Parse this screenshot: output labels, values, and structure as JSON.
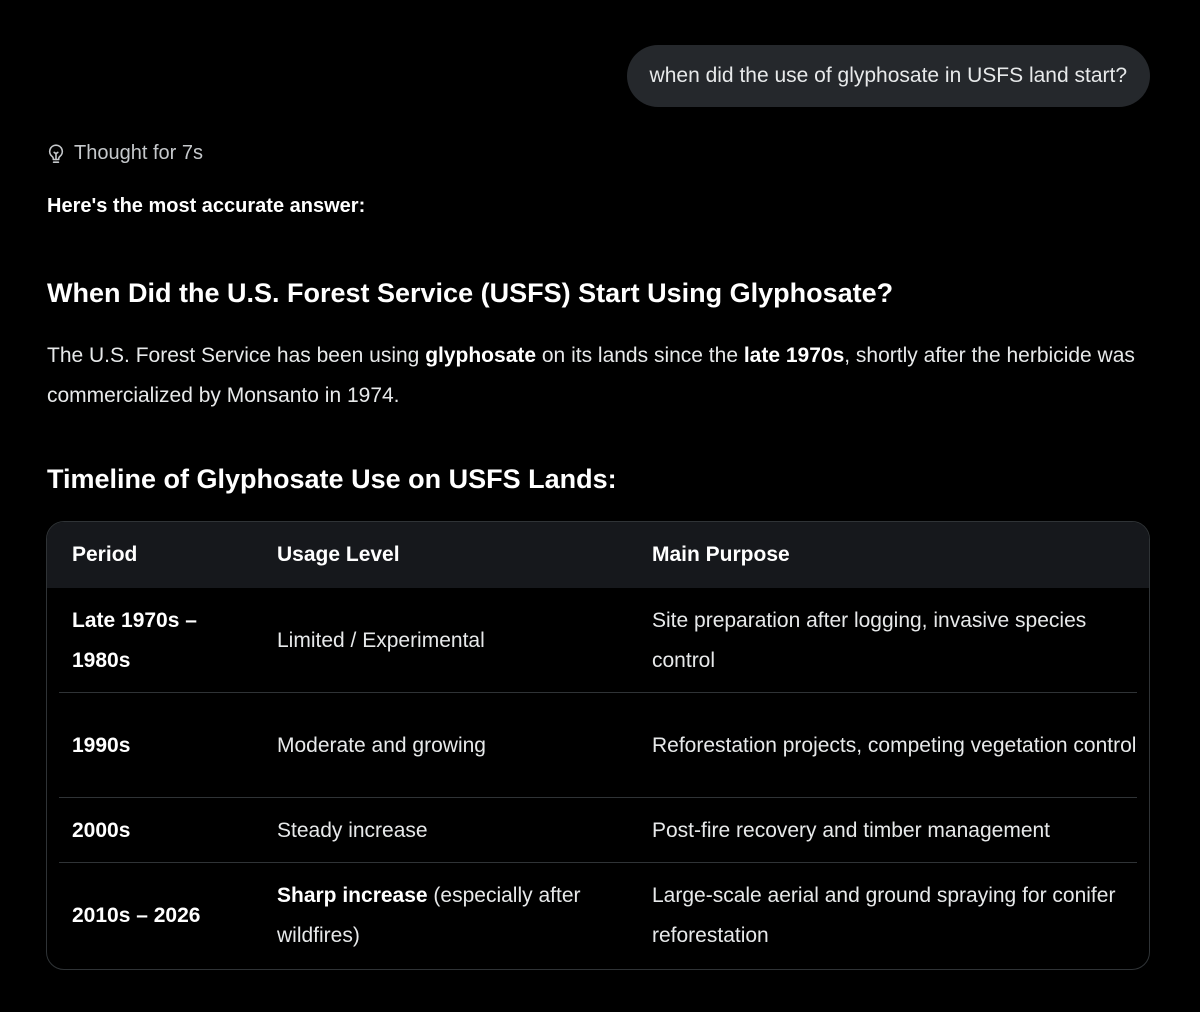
{
  "user_message": "when did the use of glyphosate in USFS land start?",
  "thought_label": "Thought for 7s",
  "answer": {
    "lead": "Here's the most accurate answer:",
    "heading": "When Did the U.S. Forest Service (USFS) Start Using Glyphosate?",
    "paragraph": {
      "part1": "The U.S. Forest Service has been using ",
      "bold1": "glyphosate",
      "part2": " on its lands since the ",
      "bold2": "late 1970s",
      "part3": ", shortly after the herbicide was commercialized by Monsanto in 1974."
    },
    "timeline_heading": "Timeline of Glyphosate Use on USFS Lands:"
  },
  "table": {
    "headers": [
      "Period",
      "Usage Level",
      "Main Purpose"
    ],
    "rows": [
      {
        "period": "Late 1970s – 1980s",
        "usage_bold": "",
        "usage": "Limited / Experimental",
        "purpose": "Site preparation after logging, invasive species control"
      },
      {
        "period": "1990s",
        "usage_bold": "",
        "usage": "Moderate and growing",
        "purpose": "Reforestation projects, competing vegetation control"
      },
      {
        "period": "2000s",
        "usage_bold": "",
        "usage": "Steady increase",
        "purpose": "Post-fire recovery and timber management"
      },
      {
        "period": "2010s – 2026",
        "usage_bold": "Sharp increase",
        "usage": " (especially after wildfires)",
        "purpose": "Large-scale aerial and ground spraying for conifer reforestation"
      }
    ]
  },
  "colors": {
    "background": "#000000",
    "bubble": "#25282c",
    "table_header": "#16181c",
    "divider": "#2f3336"
  }
}
